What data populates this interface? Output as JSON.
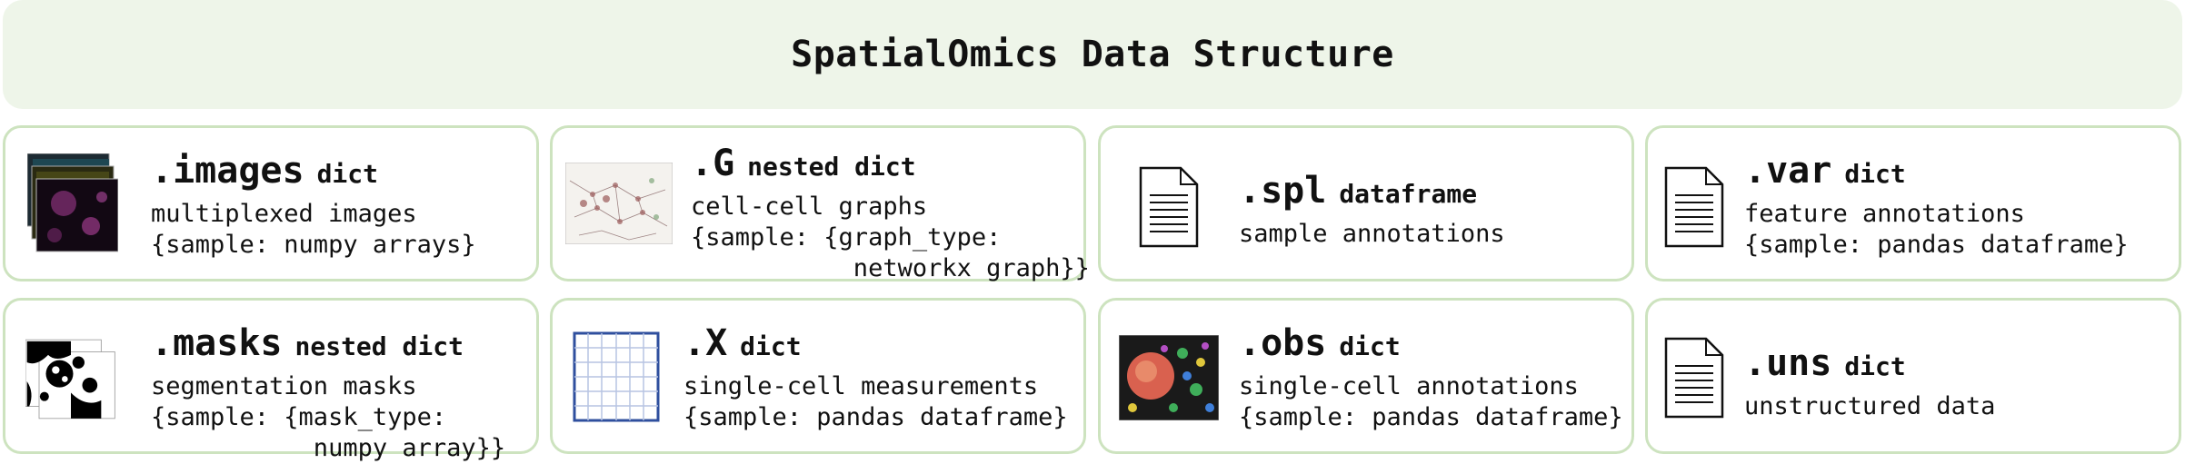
{
  "header": {
    "title": "SpatialOmics Data Structure"
  },
  "cards": [
    {
      "attr": ".images",
      "type": "dict",
      "desc": "multiplexed images",
      "sig": "{sample: numpy arrays}",
      "icon": "stacked-images-icon"
    },
    {
      "attr": ".G",
      "type": "nested dict",
      "desc": "cell-cell graphs",
      "sig": "{sample: {graph_type:\n           networkx graph}}",
      "icon": "graph-image-icon"
    },
    {
      "attr": ".spl",
      "type": "dataframe",
      "desc": "sample annotations",
      "sig": "",
      "icon": "document-icon"
    },
    {
      "attr": ".var",
      "type": "dict",
      "desc": "feature annotations",
      "sig": "{sample: pandas dataframe}",
      "icon": "document-icon"
    },
    {
      "attr": ".masks",
      "type": "nested dict",
      "desc": "segmentation masks",
      "sig": "{sample: {mask_type:\n           numpy array}}",
      "icon": "stacked-masks-icon"
    },
    {
      "attr": ".X",
      "type": "dict",
      "desc": "single-cell measurements",
      "sig": "{sample: pandas dataframe}",
      "icon": "grid-table-icon"
    },
    {
      "attr": ".obs",
      "type": "dict",
      "desc": "single-cell annotations",
      "sig": "{sample: pandas dataframe}",
      "icon": "colored-cells-image-icon"
    },
    {
      "attr": ".uns",
      "type": "dict",
      "desc": "unstructured data",
      "sig": "",
      "icon": "document-icon"
    }
  ],
  "colors": {
    "header_bg": "#eef5e9",
    "card_border": "#cde3bf",
    "grid_blue": "#2f4f9e"
  }
}
